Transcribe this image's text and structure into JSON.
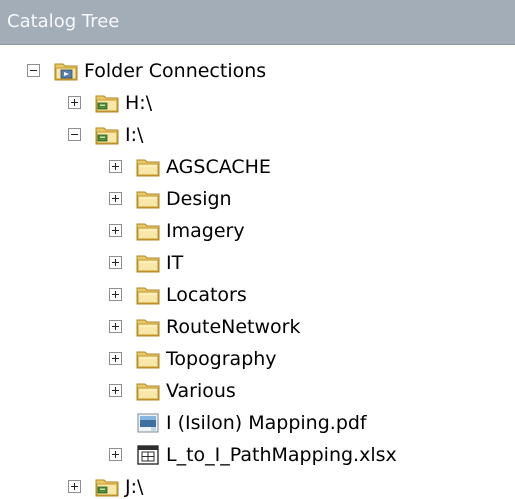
{
  "panel": {
    "title": "Catalog Tree"
  },
  "tree": [
    {
      "label": "Folder Connections",
      "depth": 0,
      "state": "expanded",
      "icon": "folder-connections-icon",
      "name": "tree-item-folder-connections"
    },
    {
      "label": "H:\\",
      "depth": 1,
      "state": "collapsed",
      "icon": "folder-connection-icon",
      "name": "tree-item-h-drive"
    },
    {
      "label": "I:\\",
      "depth": 1,
      "state": "expanded",
      "icon": "folder-connection-icon",
      "name": "tree-item-i-drive"
    },
    {
      "label": "AGSCACHE",
      "depth": 2,
      "state": "collapsed",
      "icon": "folder-icon",
      "name": "tree-item-agscache"
    },
    {
      "label": "Design",
      "depth": 2,
      "state": "collapsed",
      "icon": "folder-icon",
      "name": "tree-item-design"
    },
    {
      "label": "Imagery",
      "depth": 2,
      "state": "collapsed",
      "icon": "folder-icon",
      "name": "tree-item-imagery"
    },
    {
      "label": "IT",
      "depth": 2,
      "state": "collapsed",
      "icon": "folder-icon",
      "name": "tree-item-it"
    },
    {
      "label": "Locators",
      "depth": 2,
      "state": "collapsed",
      "icon": "folder-icon",
      "name": "tree-item-locators"
    },
    {
      "label": "RouteNetwork",
      "depth": 2,
      "state": "collapsed",
      "icon": "folder-icon",
      "name": "tree-item-routenetwork"
    },
    {
      "label": "Topography",
      "depth": 2,
      "state": "collapsed",
      "icon": "folder-icon",
      "name": "tree-item-topography"
    },
    {
      "label": "Various",
      "depth": 2,
      "state": "collapsed",
      "icon": "folder-icon",
      "name": "tree-item-various"
    },
    {
      "label": "I (Isilon) Mapping.pdf",
      "depth": 2,
      "state": "leaf",
      "icon": "pdf-file-icon",
      "name": "tree-item-isilon-mapping-pdf"
    },
    {
      "label": "L_to_I_PathMapping.xlsx",
      "depth": 2,
      "state": "collapsed",
      "icon": "spreadsheet-icon",
      "name": "tree-item-path-mapping-xlsx"
    },
    {
      "label": "J:\\",
      "depth": 1,
      "state": "collapsed",
      "icon": "folder-connection-icon",
      "name": "tree-item-j-drive"
    }
  ]
}
